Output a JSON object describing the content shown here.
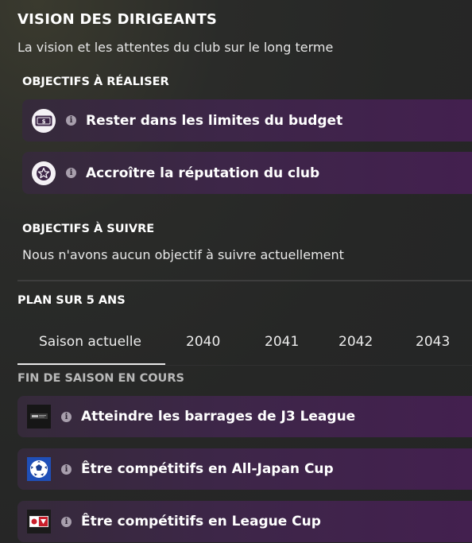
{
  "header": {
    "title": "VISION DES DIRIGEANTS",
    "subtitle": "La vision et les attentes du club sur le long terme"
  },
  "objectives_to_achieve": {
    "heading": "OBJECTIFS À RÉALISER",
    "items": [
      {
        "label": "Rester dans les limites du budget",
        "icon": "money-icon"
      },
      {
        "label": "Accroître la réputation du club",
        "icon": "star-icon"
      }
    ]
  },
  "objectives_to_follow": {
    "heading": "OBJECTIFS À SUIVRE",
    "empty_text": "Nous n'avons aucun objectif à suivre actuellement"
  },
  "five_year_plan": {
    "heading": "PLAN SUR 5 ANS",
    "tabs": [
      "Saison actuelle",
      "2040",
      "2041",
      "2042",
      "2043"
    ],
    "active_tab": "Saison actuelle"
  },
  "season_end": {
    "heading": "FIN DE SAISON EN COURS",
    "items": [
      {
        "label": "Atteindre les barrages de J3 League",
        "icon": "j3-league-logo-icon"
      },
      {
        "label": "Être compétitifs en All-Japan Cup",
        "icon": "all-japan-cup-logo-icon"
      },
      {
        "label": "Être compétitifs en League Cup",
        "icon": "league-cup-logo-icon"
      }
    ]
  },
  "colors": {
    "row_purple": "#43204f",
    "background": "#262726"
  }
}
